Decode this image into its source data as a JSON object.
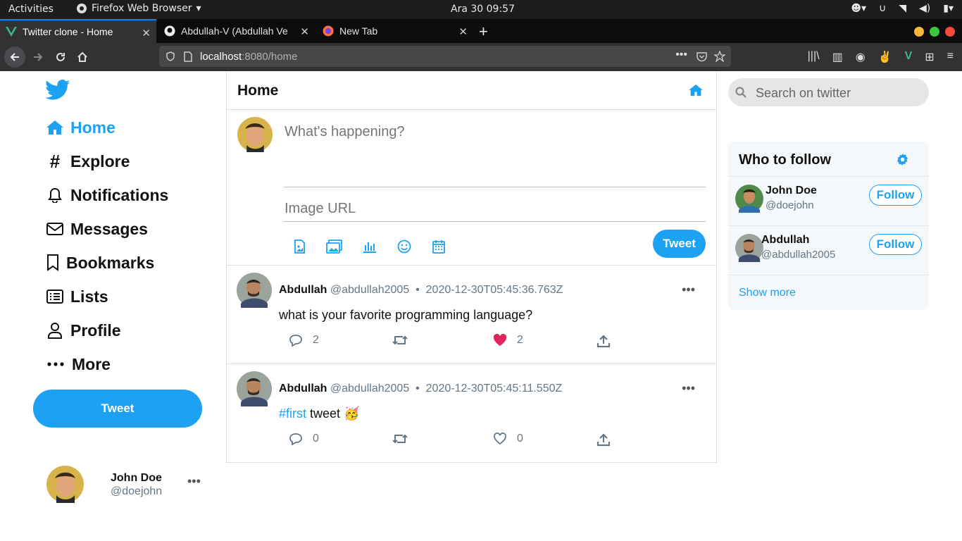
{
  "system": {
    "activities": "Activities",
    "app_name": "Firefox Web Browser",
    "clock": "Ara 30  09:57"
  },
  "browser": {
    "tabs": [
      {
        "title": "Twitter clone - Home",
        "active": true
      },
      {
        "title": "Abdullah-V (Abdullah Ve",
        "active": false
      },
      {
        "title": "New Tab",
        "active": false
      }
    ],
    "url_host": "localhost",
    "url_path": ":8080/home"
  },
  "sidebar": {
    "nav": [
      {
        "label": "Home",
        "icon": "home-icon"
      },
      {
        "label": "Explore",
        "icon": "hashtag-icon"
      },
      {
        "label": "Notifications",
        "icon": "bell-icon"
      },
      {
        "label": "Messages",
        "icon": "envelope-icon"
      },
      {
        "label": "Bookmarks",
        "icon": "bookmark-icon"
      },
      {
        "label": "Lists",
        "icon": "list-icon"
      },
      {
        "label": "Profile",
        "icon": "user-icon"
      },
      {
        "label": "More",
        "icon": "more-icon"
      }
    ],
    "tweet_button": "Tweet",
    "user": {
      "name": "John Doe",
      "handle": "@doejohn"
    }
  },
  "feed": {
    "title": "Home",
    "compose": {
      "placeholder": "What's happening?",
      "image_placeholder": "Image URL",
      "tweet_button": "Tweet"
    },
    "posts": [
      {
        "author": "Abdullah",
        "handle": "@abdullah2005",
        "timestamp": "2020-12-30T05:45:36.763Z",
        "text": "what is your favorite programming language?",
        "comments": "2",
        "likes": "2",
        "liked": true
      },
      {
        "author": "Abdullah",
        "handle": "@abdullah2005",
        "timestamp": "2020-12-30T05:45:11.550Z",
        "hashtag": "#first",
        "text": " tweet 🥳",
        "comments": "0",
        "likes": "0",
        "liked": false
      }
    ]
  },
  "right": {
    "search_placeholder": "Search on twitter",
    "who_to_follow": {
      "title": "Who to follow",
      "users": [
        {
          "name": "John Doe",
          "handle": "@doejohn",
          "button": "Follow"
        },
        {
          "name": "Abdullah",
          "handle": "@abdullah2005",
          "button": "Follow"
        }
      ],
      "show_more": "Show more"
    }
  },
  "colors": {
    "accent": "#1da1f2",
    "like": "#e0245e"
  }
}
